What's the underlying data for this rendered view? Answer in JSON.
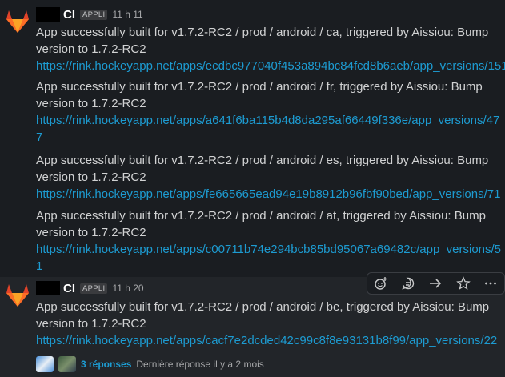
{
  "colors": {
    "background": "#1a1d21",
    "link": "#1d9bd1",
    "text": "#d1d2d3",
    "hover": "#222529"
  },
  "messages": [
    {
      "sender": "CI",
      "badge": "APPLI",
      "time": "11 h 11",
      "posts": [
        {
          "line1": "App successfully built for v1.7.2-RC2 / prod / android / ca, triggered by Aissiou: Bump",
          "line2": "version to 1.7.2-RC2",
          "link1": "https://rink.hockeyapp.net/apps/ecdbc977040f453a894bc84fcd8b6aeb/app_versions/151",
          "link2": ""
        },
        {
          "line1": "App successfully built for v1.7.2-RC2 / prod / android / fr, triggered by Aissiou: Bump",
          "line2": "version to 1.7.2-RC2",
          "link1": "https://rink.hockeyapp.net/apps/a641f6ba115b4d8da295af66449f336e/app_versions/47",
          "link2": "7"
        },
        {
          "line1": "App successfully built for v1.7.2-RC2 / prod / android / es, triggered by Aissiou: Bump",
          "line2": "version to 1.7.2-RC2",
          "link1": "https://rink.hockeyapp.net/apps/fe665665ead94e19b8912b96fbf90bed/app_versions/71",
          "link2": ""
        },
        {
          "line1": "App successfully built for v1.7.2-RC2 / prod / android / at, triggered by Aissiou: Bump",
          "line2": "version to 1.7.2-RC2",
          "link1": "https://rink.hockeyapp.net/apps/c00711b74e294bcb85bd95067a69482c/app_versions/5",
          "link2": "1"
        }
      ]
    },
    {
      "sender": "CI",
      "badge": "APPLI",
      "time": "11 h 20",
      "posts": [
        {
          "line1": "App successfully built for v1.7.2-RC2 / prod / android / be, triggered by Aissiou: Bump",
          "line2": "version to 1.7.2-RC2",
          "link1": "https://rink.hockeyapp.net/apps/cacf7e2dcded42c99c8f8e93131b8f99/app_versions/22",
          "link2": ""
        }
      ],
      "thread": {
        "count": "3 réponses",
        "last": "Dernière réponse il y a 2 mois"
      }
    }
  ],
  "toolbar": {
    "icons": [
      "emoji-add-icon",
      "reply-thread-icon",
      "share-icon",
      "star-icon",
      "more-icon"
    ]
  }
}
